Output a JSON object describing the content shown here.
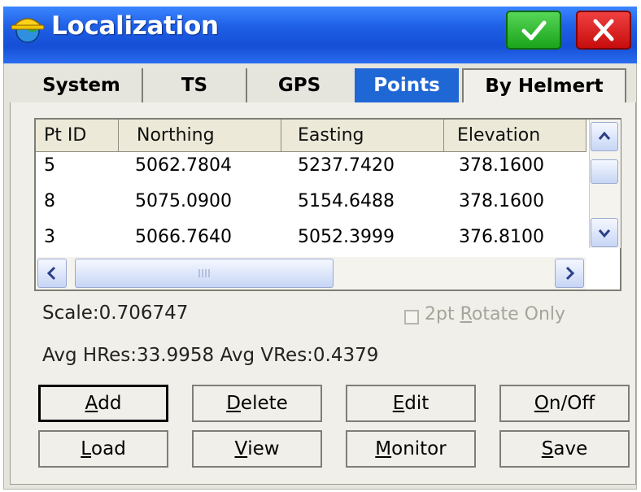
{
  "window": {
    "title": "Localization",
    "ok_icon": "checkmark-icon",
    "close_icon": "close-icon"
  },
  "colors": {
    "titlebar": "#1f60e6",
    "ok": "#1ba31b",
    "close": "#c60d0d",
    "active_tab": "#2067d6"
  },
  "tabs": [
    {
      "label": "System",
      "active": false
    },
    {
      "label": "TS",
      "active": false
    },
    {
      "label": "GPS",
      "active": false
    },
    {
      "label": "Points",
      "active": true
    },
    {
      "label": "By Helmert",
      "active": false
    }
  ],
  "table": {
    "columns": [
      "Pt ID",
      "Northing",
      "Easting",
      "Elevation"
    ],
    "rows": [
      {
        "pt_id": "5",
        "northing": "5062.7804",
        "easting": "5237.7420",
        "elevation": "378.1600"
      },
      {
        "pt_id": "8",
        "northing": "5075.0900",
        "easting": "5154.6488",
        "elevation": "378.1600"
      },
      {
        "pt_id": "3",
        "northing": "5066.7640",
        "easting": "5052.3999",
        "elevation": "376.8100"
      }
    ]
  },
  "scale_text": "Scale:0.706747",
  "avg_text": "Avg HRes:33.9958 Avg VRes:0.4379",
  "rotate_option": {
    "pre": "2pt ",
    "ul": "R",
    "post": "otate Only",
    "checked": false
  },
  "buttons": {
    "add": {
      "ul": "A",
      "rest": "dd"
    },
    "delete": {
      "ul": "D",
      "rest": "elete"
    },
    "edit": {
      "ul": "E",
      "rest": "dit"
    },
    "onoff": {
      "ul": "O",
      "rest": "n/Off"
    },
    "load": {
      "ul": "L",
      "rest": "oad"
    },
    "view": {
      "ul": "V",
      "rest": "iew"
    },
    "monitor": {
      "ul": "M",
      "rest": "onitor"
    },
    "save": {
      "ul": "S",
      "rest": "ave"
    }
  }
}
